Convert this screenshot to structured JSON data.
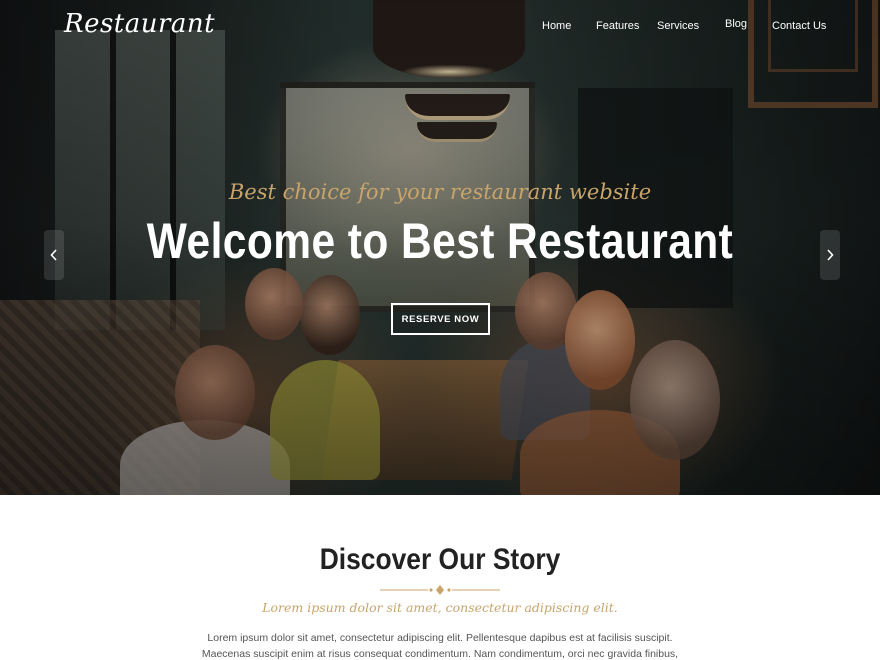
{
  "brand": {
    "logo_text": "Restaurant"
  },
  "nav": {
    "items": [
      {
        "label": "Home"
      },
      {
        "label": "Features"
      },
      {
        "label": "Services"
      },
      {
        "label": "Blog"
      },
      {
        "label": "Contact Us"
      }
    ]
  },
  "hero": {
    "tagline": "Best choice for your restaurant website",
    "headline": "Welcome to Best Restaurant",
    "cta_label": "RESERVE NOW",
    "prev_icon": "chevron-left-icon",
    "next_icon": "chevron-right-icon"
  },
  "story": {
    "title": "Discover Our Story",
    "subtitle": "Lorem ipsum dolor sit amet, consectetur adipiscing elit.",
    "body_line_1": "Lorem ipsum dolor sit amet, consectetur adipiscing elit. Pellentesque dapibus est at facilisis suscipit.",
    "body_line_2": "Maecenas suscipit enim at risus consequat condimentum. Nam condimentum, orci nec gravida finibus,"
  },
  "colors": {
    "accent": "#c9a46b",
    "heading": "#222222",
    "body_text": "#555555"
  }
}
